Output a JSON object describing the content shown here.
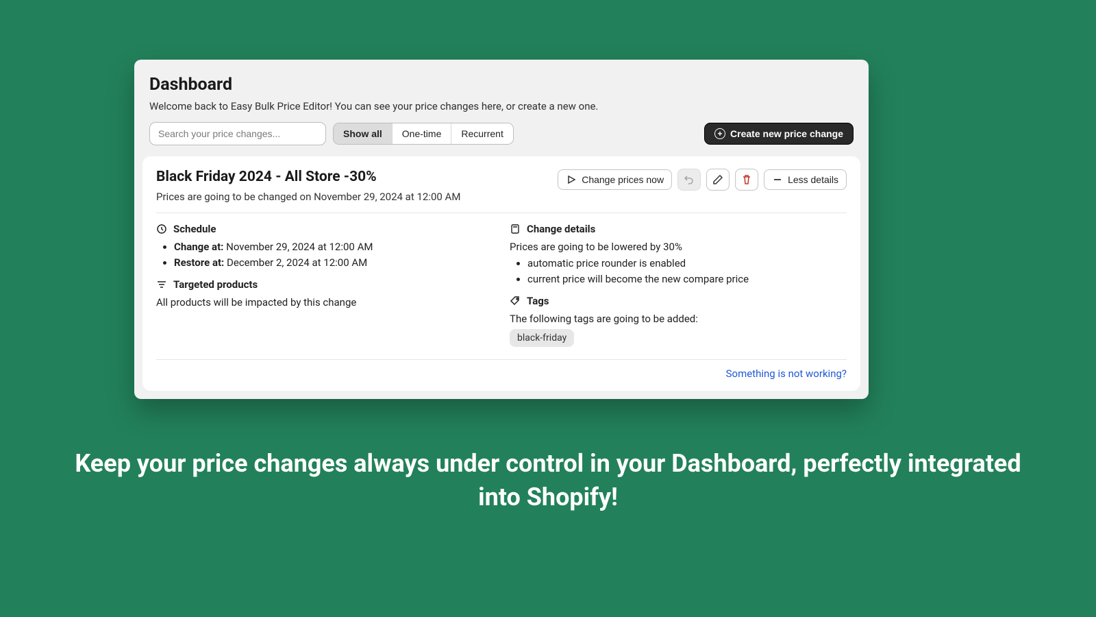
{
  "header": {
    "title": "Dashboard",
    "subtitle": "Welcome back to Easy Bulk Price Editor! You can see your price changes here, or create a new one."
  },
  "toolbar": {
    "search_placeholder": "Search your price changes...",
    "filters": {
      "all": "Show all",
      "one": "One-time",
      "rec": "Recurrent"
    },
    "create_label": "Create new price change"
  },
  "card": {
    "title": "Black Friday 2024 - All Store -30%",
    "subtitle": "Prices are going to be changed on November 29, 2024 at 12:00 AM",
    "actions": {
      "change_now": "Change prices now",
      "less_details": "Less details"
    },
    "schedule": {
      "heading": "Schedule",
      "change_label": "Change at:",
      "change_value": "November 29, 2024 at 12:00 AM",
      "restore_label": "Restore at:",
      "restore_value": "December 2, 2024 at 12:00 AM"
    },
    "targeted": {
      "heading": "Targeted products",
      "text": "All products will be impacted by this change"
    },
    "change_details": {
      "heading": "Change details",
      "intro": "Prices are going to be lowered by 30%",
      "items": {
        "0": "automatic price rounder is enabled",
        "1": "current price will become the new compare price"
      }
    },
    "tags": {
      "heading": "Tags",
      "intro": "The following tags are going to be added:",
      "tag0": "black-friday"
    },
    "footer_link": "Something is not working?"
  },
  "caption": "Keep your price changes always under control in your Dashboard, perfectly integrated into Shopify!"
}
